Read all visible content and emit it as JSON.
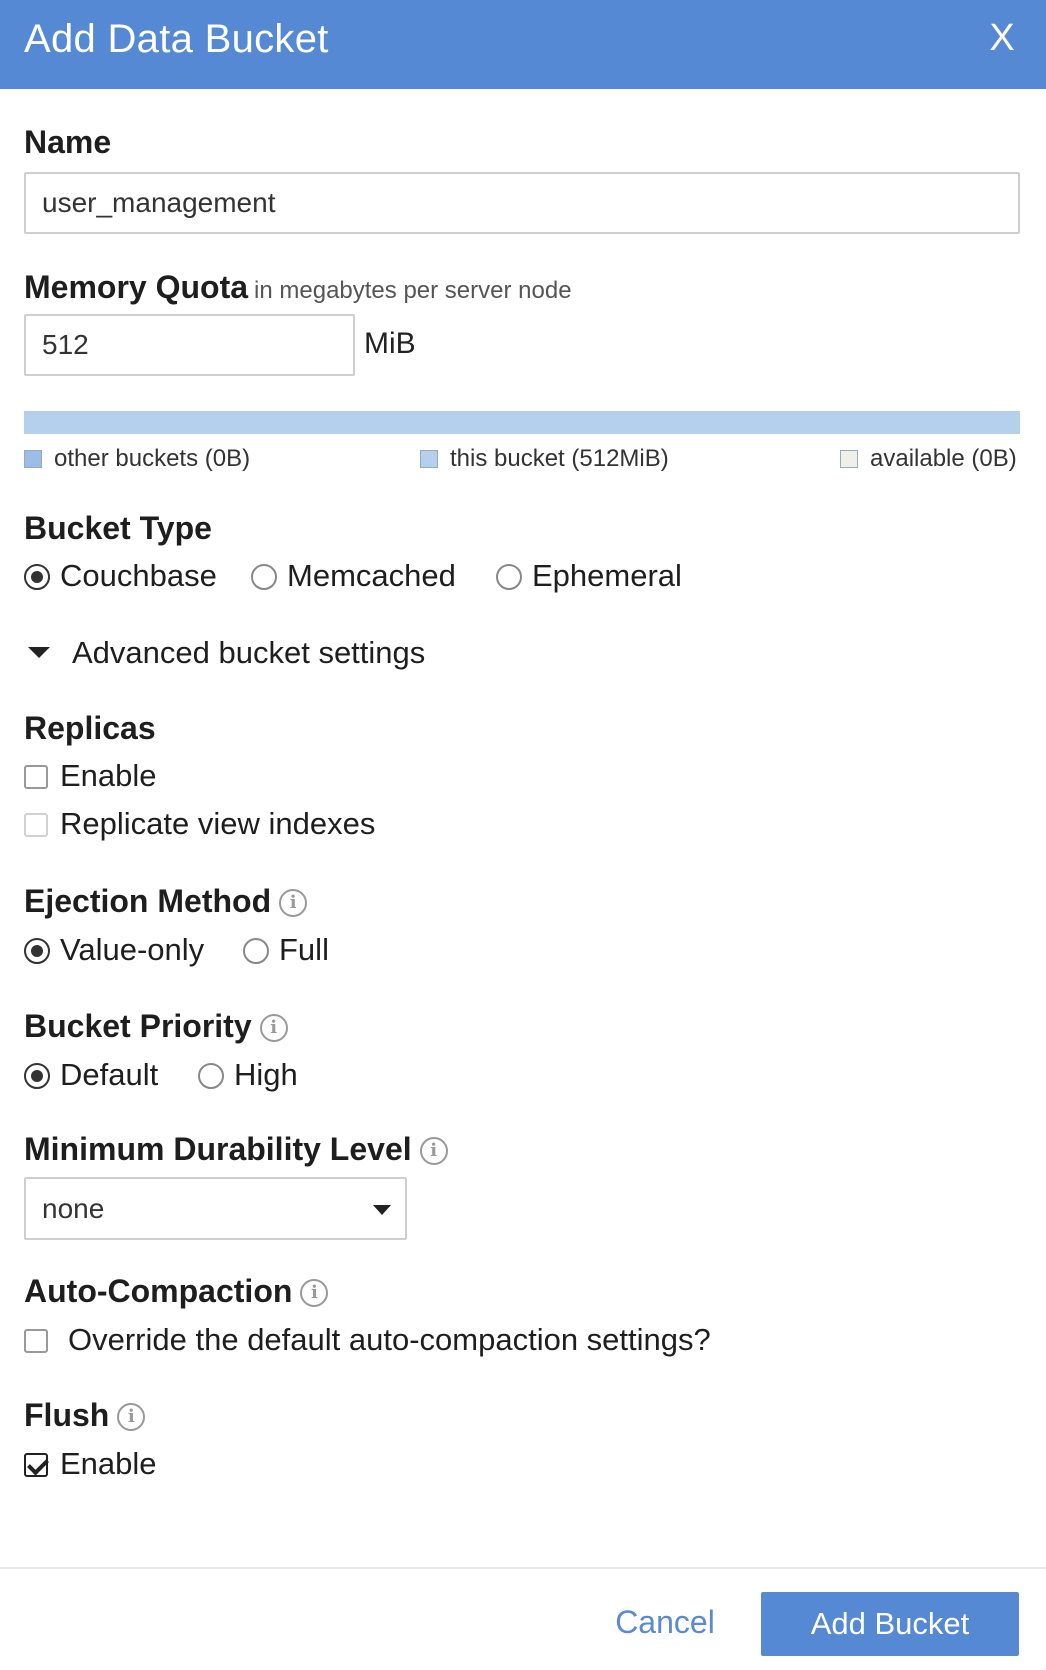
{
  "header": {
    "title": "Add Data Bucket",
    "close_label": "X"
  },
  "name": {
    "label": "Name",
    "value": "user_management"
  },
  "memory_quota": {
    "label": "Memory Quota",
    "hint": "in megabytes per server node",
    "value": "512",
    "unit": "MiB",
    "bar_fill_fraction": 1.0,
    "legend": {
      "other": "other buckets (0B)",
      "this": "this bucket (512MiB)",
      "available": "available (0B)"
    },
    "colors": {
      "other": "#9bbde6",
      "this": "#b5d0ec",
      "available": "#f0efe8"
    }
  },
  "bucket_type": {
    "label": "Bucket Type",
    "options": [
      "Couchbase",
      "Memcached",
      "Ephemeral"
    ],
    "selected": "Couchbase"
  },
  "advanced": {
    "label": "Advanced bucket settings",
    "expanded": true
  },
  "replicas": {
    "label": "Replicas",
    "enable_label": "Enable",
    "enable_checked": false,
    "replicate_label": "Replicate view indexes",
    "replicate_checked": false
  },
  "ejection": {
    "label": "Ejection Method",
    "options": [
      "Value-only",
      "Full"
    ],
    "selected": "Value-only"
  },
  "priority": {
    "label": "Bucket Priority",
    "options": [
      "Default",
      "High"
    ],
    "selected": "Default"
  },
  "durability": {
    "label": "Minimum Durability Level",
    "value": "none"
  },
  "auto_compaction": {
    "label": "Auto-Compaction",
    "override_label": "Override the default auto-compaction settings?",
    "override_checked": false
  },
  "flush": {
    "label": "Flush",
    "enable_label": "Enable",
    "enable_checked": true
  },
  "footer": {
    "cancel_label": "Cancel",
    "submit_label": "Add Bucket"
  },
  "icons": {
    "info": "info-circle-icon",
    "close": "close-icon",
    "expand": "caret-down-icon"
  },
  "theme": {
    "accent": "#5589d3",
    "link": "#5a8ad0"
  }
}
